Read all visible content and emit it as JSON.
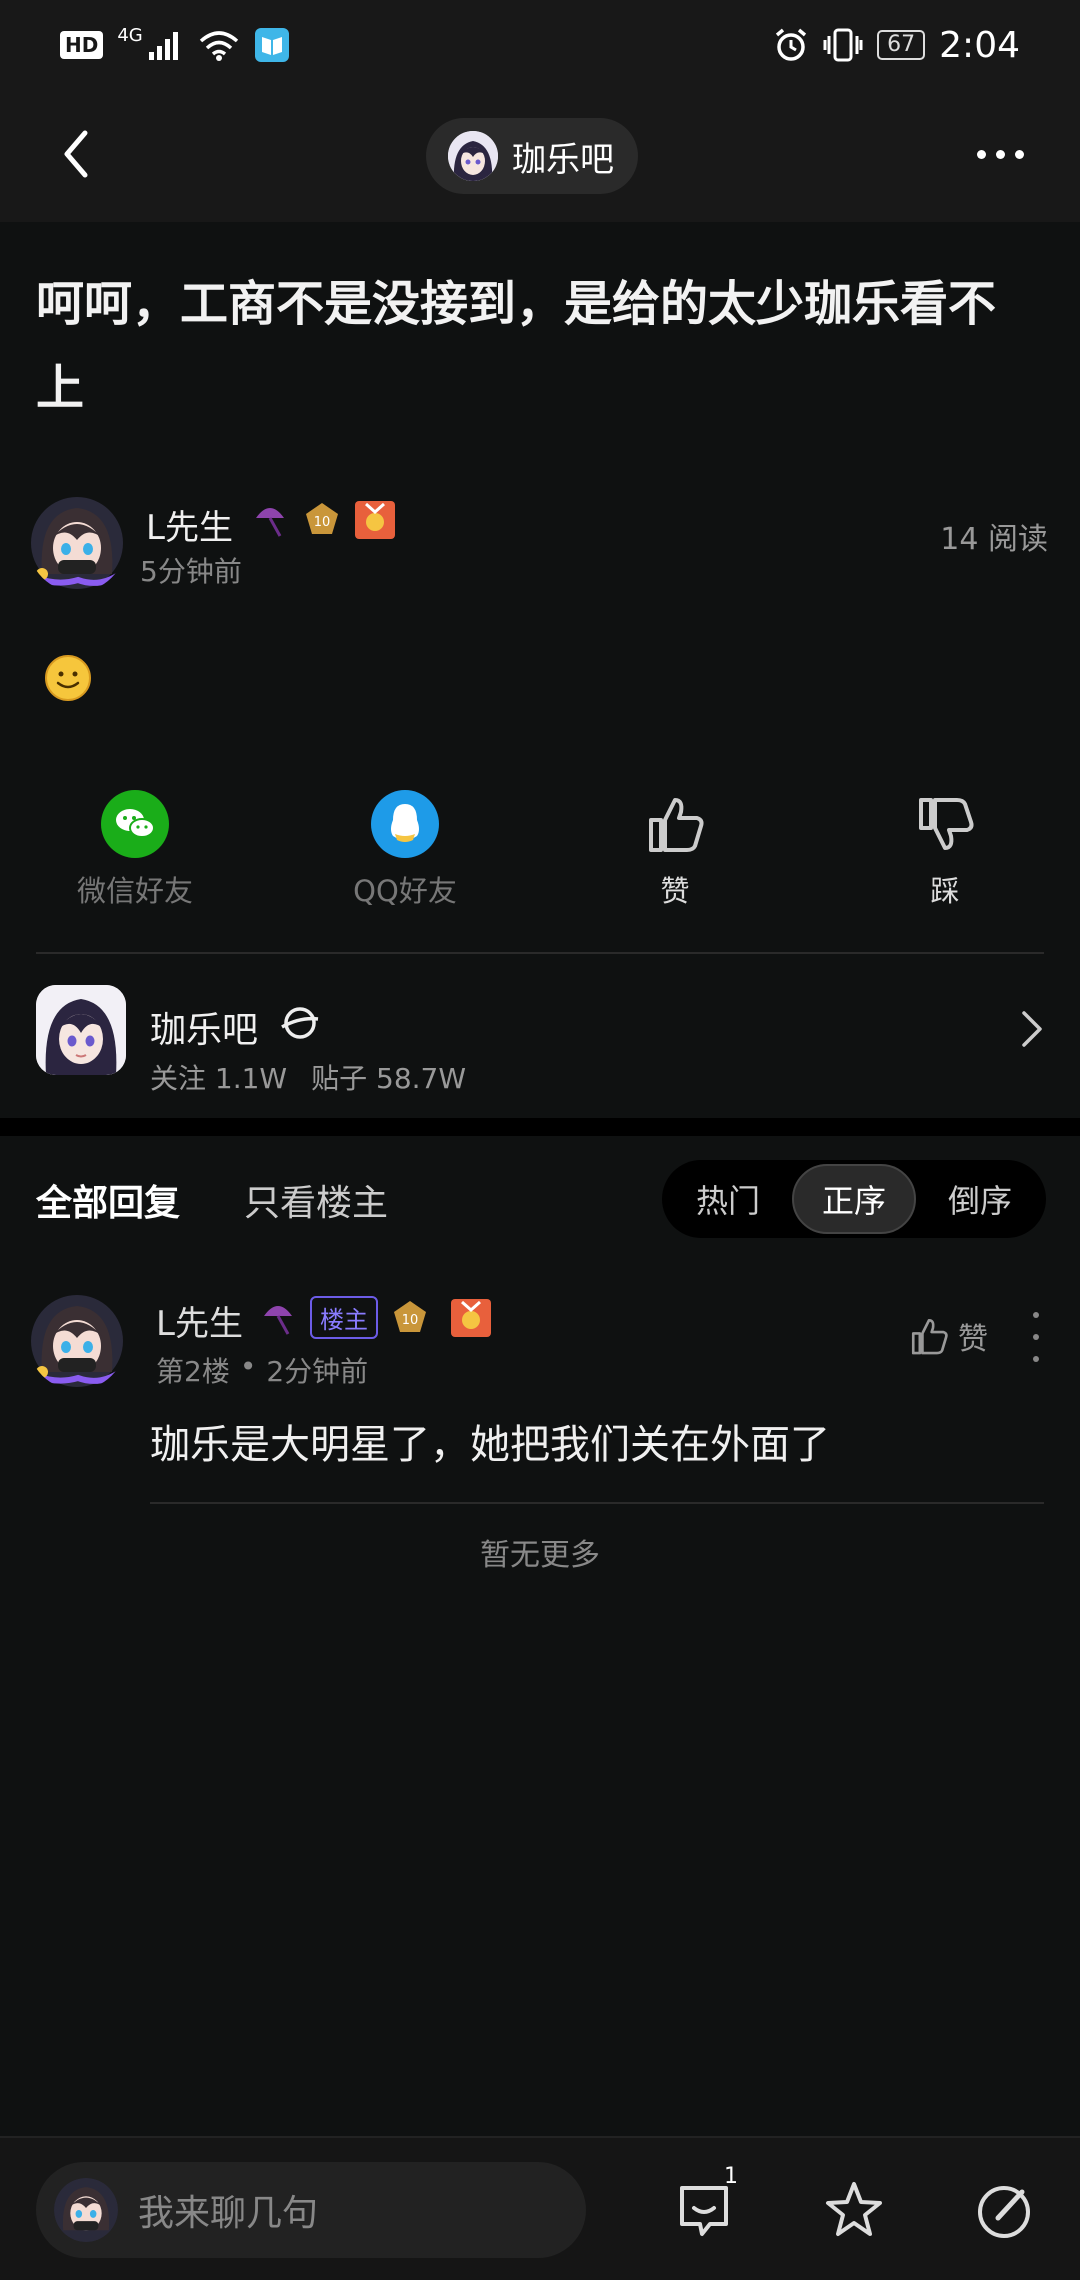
{
  "status_bar": {
    "hd": "HD",
    "network": "4G",
    "battery": "67",
    "time": "2:04"
  },
  "nav": {
    "forum_name": "珈乐吧"
  },
  "post": {
    "title": "呵呵，工商不是没接到，是给的太少珈乐看不上",
    "author_name": "L先生",
    "level": "10",
    "time": "5分钟前",
    "read_count": "14 阅读"
  },
  "share": {
    "wechat": "微信好友",
    "qq": "QQ好友",
    "like": "赞",
    "dislike": "踩"
  },
  "forum_card": {
    "name": "珈乐吧",
    "followers": "关注 1.1W",
    "posts": "贴子 58.7W"
  },
  "reply_tabs": {
    "all": "全部回复",
    "owner_only": "只看楼主"
  },
  "sort": {
    "hot": "热门",
    "asc": "正序",
    "desc": "倒序"
  },
  "reply": {
    "author_name": "L先生",
    "owner_tag": "楼主",
    "level": "10",
    "floor": "第2楼",
    "separator": "•",
    "time": "2分钟前",
    "like": "赞",
    "text": "珈乐是大明星了，她把我们关在外面了"
  },
  "no_more": "暂无更多",
  "bottom_bar": {
    "placeholder": "我来聊几句",
    "comment_count": "1"
  },
  "colors": {
    "background": "#0f1111",
    "wechat_green": "#1aad19",
    "qq_blue": "#1e9be8",
    "owner_tag_purple": "#6c5ce7"
  }
}
